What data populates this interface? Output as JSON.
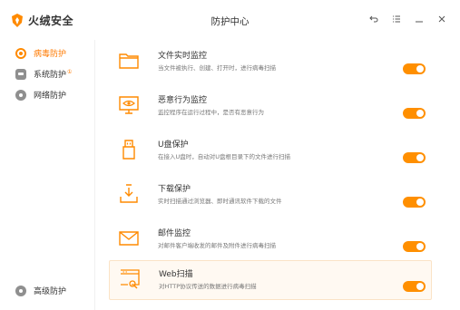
{
  "app": {
    "brand": "火绒安全",
    "window_title": "防护中心"
  },
  "window_controls": [
    "back-icon",
    "menu-icon",
    "minimize-icon",
    "close-icon"
  ],
  "sidebar": {
    "items": [
      {
        "label": "病毒防护",
        "active": true
      },
      {
        "label": "系统防护",
        "badge": "①",
        "active": false
      },
      {
        "label": "网络防护",
        "active": false
      }
    ],
    "bottom_item": {
      "label": "高级防护"
    }
  },
  "protections": [
    {
      "title": "文件实时监控",
      "desc": "当文件被执行、创建、打开时，进行病毒扫描",
      "enabled": true,
      "icon": "folder-icon"
    },
    {
      "title": "恶意行为监控",
      "desc": "监控程序在运行过程中，是否有恶意行为",
      "enabled": true,
      "icon": "monitor-eye-icon"
    },
    {
      "title": "U盘保护",
      "desc": "在接入U盘时，自动对U盘根目录下的文件进行扫描",
      "enabled": true,
      "icon": "usb-icon"
    },
    {
      "title": "下载保护",
      "desc": "实时扫描通过浏览器、即时通讯软件下载的文件",
      "enabled": true,
      "icon": "download-icon"
    },
    {
      "title": "邮件监控",
      "desc": "对邮件客户端收发的邮件及附件进行病毒扫描",
      "enabled": true,
      "icon": "mail-icon"
    },
    {
      "title": "Web扫描",
      "desc": "对HTTP协议传送的数据进行病毒扫描",
      "enabled": true,
      "icon": "web-scan-icon"
    }
  ],
  "colors": {
    "accent": "#ff8f00",
    "active_text": "#ff7a00",
    "highlight_bg": "#fff9f2"
  }
}
